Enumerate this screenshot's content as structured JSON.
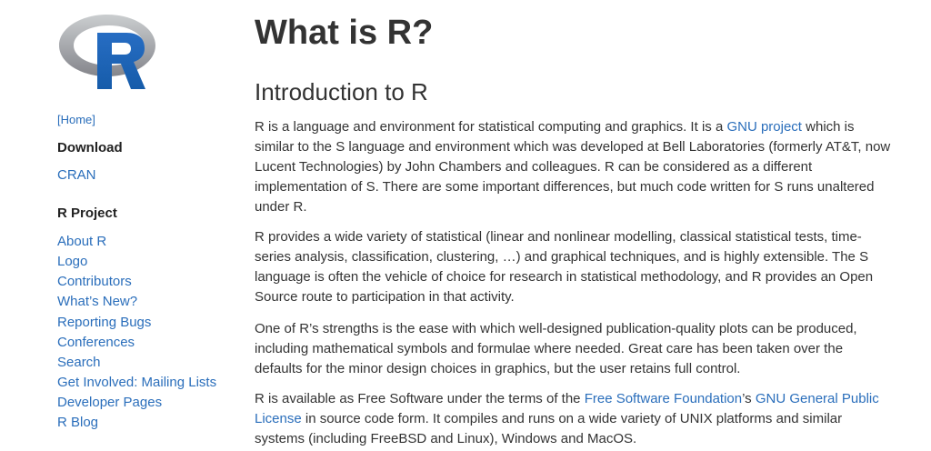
{
  "sidebar": {
    "logo_letter": "R",
    "home_link": "[Home]",
    "download_heading": "Download",
    "download_links": [
      "CRAN"
    ],
    "project_heading": "R Project",
    "project_links": [
      "About R",
      "Logo",
      "Contributors",
      "What’s New?",
      "Reporting Bugs",
      "Conferences",
      "Search",
      "Get Involved: Mailing Lists",
      "Developer Pages",
      "R Blog"
    ]
  },
  "main": {
    "title": "What is R?",
    "subtitle": "Introduction to R",
    "p1": {
      "t1": "R is a language and environment for statistical computing and graphics. It is a ",
      "link1": "GNU project",
      "t2": " which is similar to the S language and environment which was developed at Bell Laboratories (formerly AT&T, now Lucent Technologies) by John Chambers and colleagues. R can be considered as a different implementation of S. There are some important differences, but much code written for S runs unaltered under R."
    },
    "p2": "R provides a wide variety of statistical (linear and nonlinear modelling, classical statistical tests, time-series analysis, classification, clustering, …) and graphical techniques, and is highly extensible. The S language is often the vehicle of choice for research in statistical methodology, and R provides an Open Source route to participation in that activity.",
    "p3": "One of R’s strengths is the ease with which well-designed publication-quality plots can be produced, including mathematical symbols and formulae where needed. Great care has been taken over the defaults for the minor design choices in graphics, but the user retains full control.",
    "p4": {
      "t1": "R is available as Free Software under the terms of the ",
      "link1": "Free Software Foundation",
      "t2": "’s ",
      "link2": "GNU General Public License",
      "t3": " in source code form. It compiles and runs on a wide variety of UNIX platforms and similar systems (including FreeBSD and Linux), Windows and MacOS."
    }
  },
  "colors": {
    "link": "#2a6ebb",
    "text": "#333333",
    "logo_blue": "#276dc3",
    "logo_gray": "#a6a8ad"
  }
}
